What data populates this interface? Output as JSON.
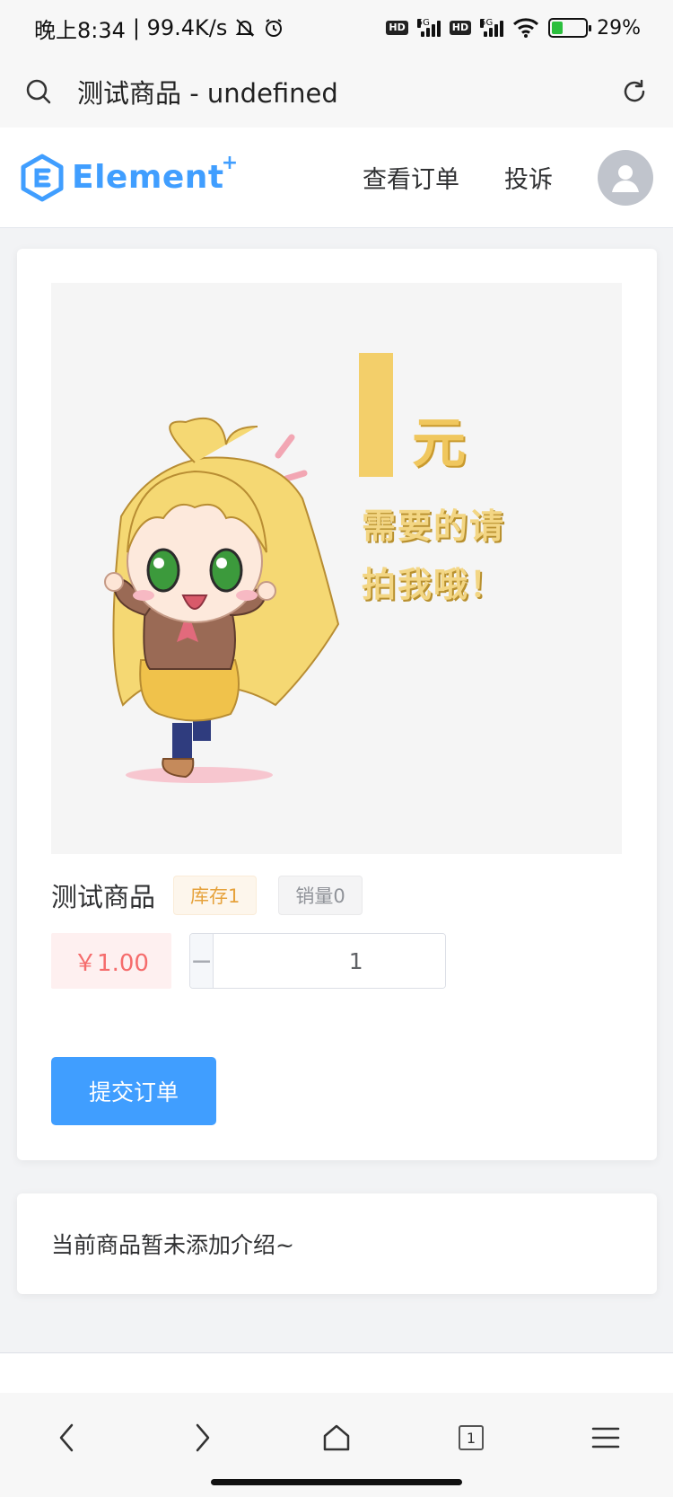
{
  "status_bar": {
    "time": "晚上8:34",
    "speed": "| 99.4K/s",
    "net1": "5G",
    "net2": "5G",
    "hd": "HD",
    "battery": "29%"
  },
  "browser": {
    "title": "测试商品 - undefined"
  },
  "header": {
    "logo_text": "Element",
    "logo_plus": "+",
    "nav": {
      "view_orders": "查看订单",
      "complaint": "投诉"
    }
  },
  "product": {
    "image_text": {
      "big_number": "1",
      "unit": "元",
      "line1": "需要的请",
      "line2": "拍我哦！"
    },
    "name": "测试商品",
    "stock_tag": "库存1",
    "sales_tag": "销量0",
    "price": "￥1.00",
    "quantity": "1",
    "minus": "−",
    "plus": "+",
    "submit_label": "提交订单"
  },
  "description": {
    "text": "当前商品暂未添加介绍~"
  },
  "toolbar": {
    "tab_count": "1"
  },
  "colors": {
    "primary": "#409eff",
    "price_red": "#f56c6c",
    "warning": "#e6a23c",
    "info": "#909399"
  },
  "icons": [
    "search-icon",
    "refresh-icon",
    "element-logo-icon",
    "avatar-user-icon",
    "back-icon",
    "forward-icon",
    "home-icon",
    "tabs-icon",
    "menu-icon"
  ]
}
